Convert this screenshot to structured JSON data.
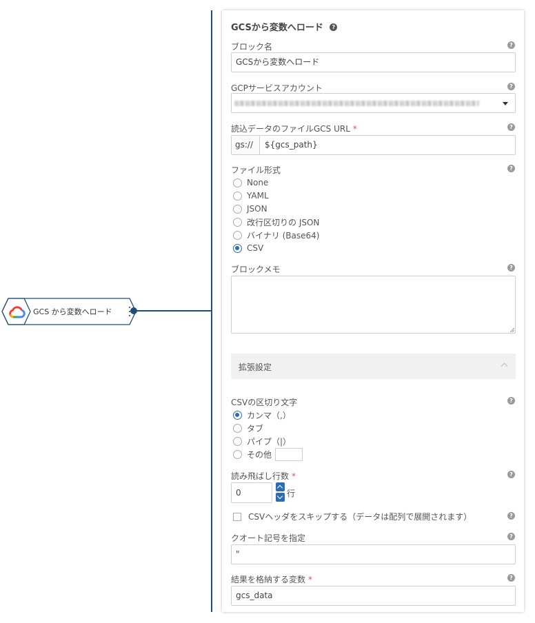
{
  "node": {
    "label": "GCS から変数へロード",
    "icon": "google-cloud-icon"
  },
  "panel": {
    "title": "GCSから変数へロード",
    "help_glyph": "?",
    "block_name": {
      "label": "ブロック名",
      "value": "GCSから変数へロード"
    },
    "service_account": {
      "label": "GCPサービスアカウント"
    },
    "gcs_url": {
      "label": "読込データのファイルGCS URL",
      "required": "*",
      "prefix": "gs://",
      "value": "${gcs_path}"
    },
    "file_format": {
      "label": "ファイル形式",
      "options": [
        "None",
        "YAML",
        "JSON",
        "改行区切りの JSON",
        "バイナリ (Base64)",
        "CSV"
      ],
      "selected": "CSV"
    },
    "block_memo": {
      "label": "ブロックメモ",
      "value": ""
    },
    "advanced": {
      "label": "拡張設定"
    },
    "csv_delimiter": {
      "label": "CSVの区切り文字",
      "options": [
        "カンマ（,）",
        "タブ",
        "パイプ（|）",
        "その他"
      ],
      "selected": "カンマ（,）"
    },
    "skip_rows": {
      "label": "読み飛ばし行数",
      "required": "*",
      "value": "0",
      "unit": "行"
    },
    "skip_header": {
      "label": "CSVヘッダをスキップする（データは配列で展開されます）"
    },
    "quote_char": {
      "label": "クオート記号を指定",
      "value": "\""
    },
    "result_var": {
      "label": "結果を格納する変数",
      "required": "*",
      "value": "gcs_data"
    }
  },
  "colors": {
    "accent": "#2a6db5",
    "connector": "#1f4e79",
    "required": "#d9534f"
  }
}
